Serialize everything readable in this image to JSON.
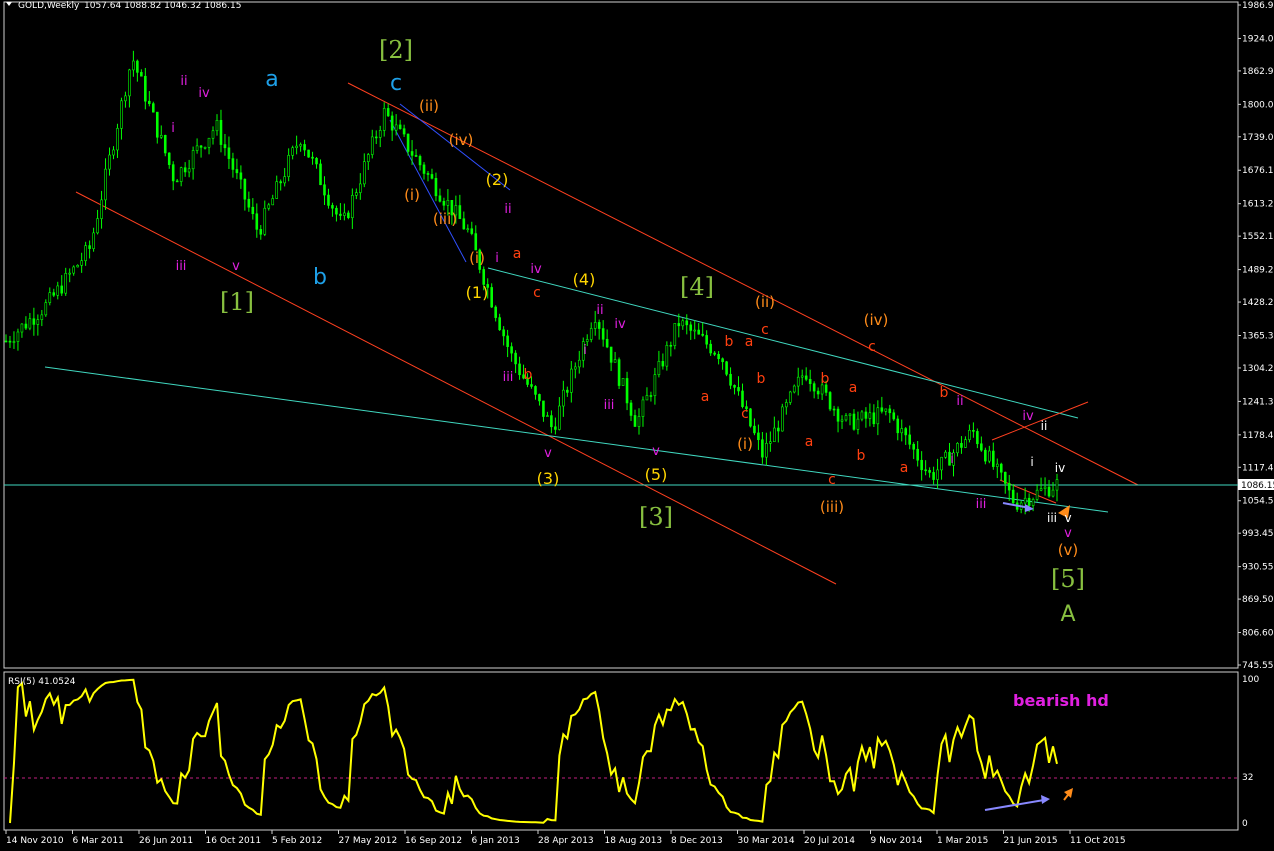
{
  "header": {
    "symbol_text": "GOLD,Weekly",
    "ohlc_text": "1057.64 1088.82 1046.32 1086.15"
  },
  "rsi_header": "RSI(5) 41.0524",
  "price_marker": "1086.15",
  "annotation": "bearish hd",
  "colors": {
    "background": "#000000",
    "candle": "#00ff00",
    "rsi_line": "#ffff00",
    "channel_red": "#ff4020",
    "channel_cyan": "#40d8c0",
    "wave_green": "#88c040",
    "wave_blue": "#1ea0e8",
    "wave_yellow": "#ffd500",
    "wave_orange": "#ff8c1a",
    "wave_magenta": "#e020e0",
    "wave_red": "#ff4010",
    "wave_white": "#ffffff",
    "divergence_arrow": "#8888ff",
    "annotation": "#e020e0"
  },
  "chart_data": [
    {
      "type": "candlestick",
      "title": "GOLD,Weekly",
      "ylim": [
        745.55,
        1986.9
      ],
      "y_ticks": [
        "1986.90",
        "1924.00",
        "1862.95",
        "1800.05",
        "1739.00",
        "1676.10",
        "1613.20",
        "1552.15",
        "1489.25",
        "1428.20",
        "1365.30",
        "1304.25",
        "1241.35",
        "1178.45",
        "1117.40",
        "1054.50",
        "993.45",
        "930.55",
        "869.50",
        "806.60",
        "745.55"
      ],
      "x_ticks": [
        "14 Nov 2010",
        "6 Mar 2011",
        "26 Jun 2011",
        "16 Oct 2011",
        "5 Feb 2012",
        "27 May 2012",
        "16 Sep 2012",
        "6 Jan 2013",
        "28 Apr 2013",
        "18 Aug 2013",
        "8 Dec 2013",
        "30 Mar 2014",
        "20 Jul 2014",
        "9 Nov 2014",
        "1 Mar 2015",
        "21 Jun 2015",
        "11 Oct 2015"
      ],
      "last_ohlc": {
        "open": 1057.64,
        "high": 1088.82,
        "low": 1046.32,
        "close": 1086.15
      },
      "price_path": [
        {
          "x": "14 Nov 2010",
          "y": 1355
        },
        {
          "x": "6 Mar 2011",
          "y": 1425
        },
        {
          "x": "26 Jun 2011",
          "y": 1530
        },
        {
          "x": "Aug 2011",
          "y": 1890
        },
        {
          "x": "16 Oct 2011",
          "y": 1660
        },
        {
          "x": "Nov 2011",
          "y": 1760
        },
        {
          "x": "Dec 2011",
          "y": 1560
        },
        {
          "x": "5 Feb 2012",
          "y": 1740
        },
        {
          "x": "27 May 2012",
          "y": 1570
        },
        {
          "x": "16 Sep 2012",
          "y": 1785
        },
        {
          "x": "6 Jan 2013",
          "y": 1670
        },
        {
          "x": "Feb 2013",
          "y": 1560
        },
        {
          "x": "28 Apr 2013",
          "y": 1330
        },
        {
          "x": "Jun 2013",
          "y": 1190
        },
        {
          "x": "18 Aug 2013",
          "y": 1410
        },
        {
          "x": "8 Dec 2013",
          "y": 1200
        },
        {
          "x": "30 Mar 2014",
          "y": 1390
        },
        {
          "x": "20 Jul 2014",
          "y": 1330
        },
        {
          "x": "9 Nov 2014",
          "y": 1140
        },
        {
          "x": "Jan 2015",
          "y": 1300
        },
        {
          "x": "1 Mar 2015",
          "y": 1200
        },
        {
          "x": "May 2015",
          "y": 1220
        },
        {
          "x": "21 Jun 2015",
          "y": 1100
        },
        {
          "x": "11 Oct 2015",
          "y": 1185
        },
        {
          "x": "Nov 2015",
          "y": 1050
        },
        {
          "x": "Dec 2015",
          "y": 1086.15
        }
      ],
      "wave_labels": [
        "[1]",
        "[2]",
        "[3]",
        "[4]",
        "[5]",
        "a",
        "b",
        "c",
        "(1)",
        "(2)",
        "(3)",
        "(4)",
        "(5)",
        "(i)",
        "(ii)",
        "(iii)",
        "(iv)",
        "(v)",
        "i",
        "ii",
        "iii",
        "iv",
        "v",
        "A"
      ]
    },
    {
      "type": "line",
      "title": "RSI(5) 41.0524",
      "ylim": [
        0,
        100
      ],
      "y_ticks": [
        "100",
        "32",
        "0"
      ],
      "last_value": 41.0524,
      "reference_level": 32,
      "annotation": "bearish hd"
    }
  ]
}
